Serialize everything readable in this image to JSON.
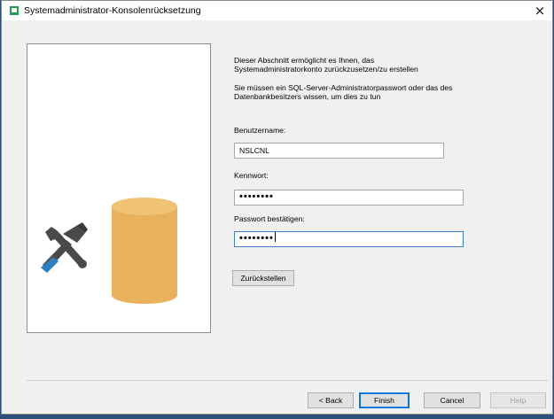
{
  "window": {
    "title": "Systemadministrator-Konsolenrücksetzung",
    "close_glyph": "×",
    "icon": "app-icon"
  },
  "illustration": {
    "icons": [
      "tools-icon",
      "database-icon"
    ],
    "colors": {
      "database": "#e8b25d",
      "tools": "#4a4a4a",
      "handle": "#2e7fc0"
    }
  },
  "description": {
    "line1": "Dieser Abschnitt ermöglicht es Ihnen, das",
    "line2": "Systemadministratorkonto zurückzusetzen/zu erstellen",
    "line3": "Sie müssen ein SQL-Server-Administratorpasswort oder das des",
    "line4": "Datenbankbesitzers wissen, um dies zu tun"
  },
  "form": {
    "username_label": "Benutzername:",
    "username_value": "NSLCNL",
    "password_label": "Kennwort:",
    "password_value": "••••••••",
    "confirm_label": "Passwort bestätigen:",
    "confirm_value": "••••••••",
    "reset_button": "Zurückstellen"
  },
  "footer": {
    "back_button": "< Back",
    "finish_button": "Finish",
    "cancel_button": "Cancel",
    "help_button": "Help"
  },
  "colors": {
    "focus_border": "#3d80c6",
    "primary_button_border": "#0078d7",
    "background": "#2b4f78"
  }
}
